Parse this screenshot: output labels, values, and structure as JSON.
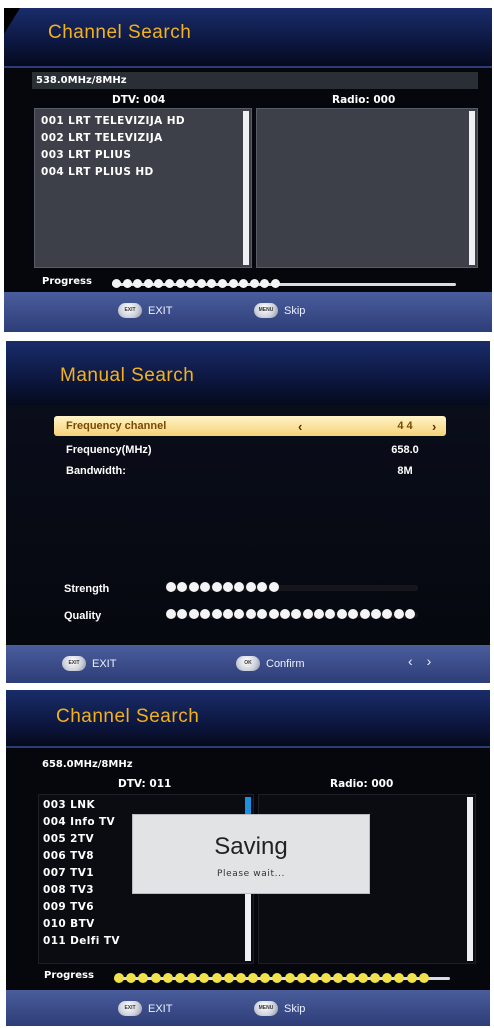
{
  "screen1": {
    "title": "Channel Search",
    "frequency": "538.0MHz/8MHz",
    "dtv": "DTV: 004",
    "radio": "Radio: 000",
    "channels": [
      "001  LRT TELEVIZIJA HD",
      "002  LRT TELEVIZIJA",
      "003  LRT PLIUS",
      "004  LRT PLIUS HD"
    ],
    "progress_label": "Progress",
    "progress_dots": 16,
    "progress_fraction": 0.56,
    "exit_label": "EXIT",
    "skip_label": "Skip"
  },
  "screen2": {
    "title": "Manual Search",
    "rows": [
      {
        "label": "Frequency channel",
        "value": "4 4"
      },
      {
        "label": "Frequency(MHz)",
        "value": "658.0"
      },
      {
        "label": "Bandwidth:",
        "value": "8M"
      }
    ],
    "strength_label": "Strength",
    "quality_label": "Quality",
    "strength_dots": 10,
    "quality_dots": 22,
    "exit_label": "EXIT",
    "confirm_label": "Confirm"
  },
  "screen3": {
    "title": "Channel Search",
    "frequency": "658.0MHz/8MHz",
    "dtv": "DTV: 011",
    "radio": "Radio: 000",
    "channels": [
      "003 LNK",
      "004 Info TV",
      "005 2TV",
      "006 TV8",
      "007 TV1",
      "008 TV3",
      "009 TV6",
      "010 BTV",
      "011 Delfi TV"
    ],
    "modal_title": "Saving",
    "modal_sub": "Please wait...",
    "progress_label": "Progress",
    "progress_dots": 26,
    "exit_label": "EXIT",
    "skip_label": "Skip"
  },
  "colors": {
    "title": "#f3b21c",
    "dot_white": "#f4f4f6",
    "dot_yellow": "#f2e24a",
    "highlight": "#f6d277"
  }
}
